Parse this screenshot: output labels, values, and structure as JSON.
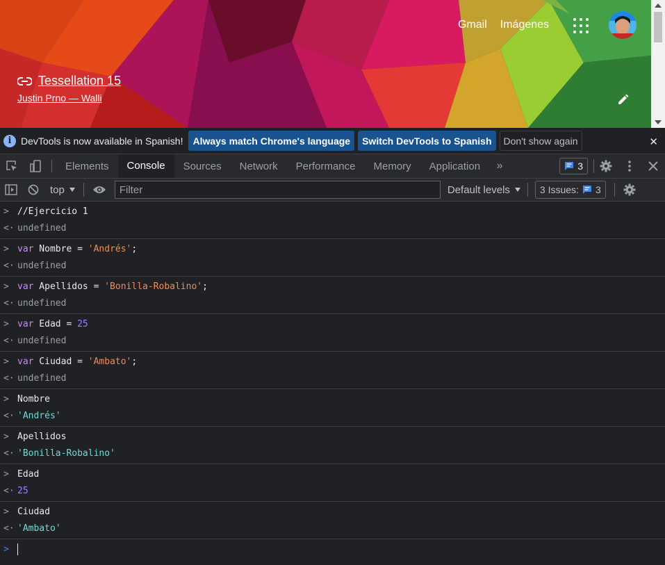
{
  "page": {
    "links": [
      "Gmail",
      "Imágenes"
    ],
    "credit_title": "Tessellation 15",
    "credit_author": "Justin Prno — Walli"
  },
  "infobar": {
    "message": "DevTools is now available in Spanish!",
    "btn_match": "Always match Chrome's language",
    "btn_switch": "Switch DevTools to Spanish",
    "btn_dismiss": "Don't show again",
    "close": "✕"
  },
  "tabs": [
    "Elements",
    "Console",
    "Sources",
    "Network",
    "Performance",
    "Memory",
    "Application"
  ],
  "active_tab": "Console",
  "tabbar": {
    "issue_count": "3"
  },
  "toolbar": {
    "context": "top",
    "filter_placeholder": "Filter",
    "levels": "Default levels",
    "issues_label": "3 Issues:",
    "issues_count": "3"
  },
  "console": {
    "entries": [
      {
        "input": [
          {
            "t": "//Ejercicio 1",
            "c": "plain"
          }
        ],
        "output": "undefined",
        "out_type": "undef"
      },
      {
        "input": [
          {
            "t": "var",
            "c": "kw"
          },
          {
            "t": " Nombre = ",
            "c": "plain"
          },
          {
            "t": "'Andrés'",
            "c": "str"
          },
          {
            "t": ";",
            "c": "plain"
          }
        ],
        "output": "undefined",
        "out_type": "undef"
      },
      {
        "input": [
          {
            "t": "var",
            "c": "kw"
          },
          {
            "t": " Apellidos = ",
            "c": "plain"
          },
          {
            "t": "'Bonilla-Robalino'",
            "c": "str"
          },
          {
            "t": ";",
            "c": "plain"
          }
        ],
        "output": "undefined",
        "out_type": "undef"
      },
      {
        "input": [
          {
            "t": "var",
            "c": "kw"
          },
          {
            "t": " Edad = ",
            "c": "plain"
          },
          {
            "t": "25",
            "c": "num"
          }
        ],
        "output": "undefined",
        "out_type": "undef"
      },
      {
        "input": [
          {
            "t": "var",
            "c": "kw"
          },
          {
            "t": " Ciudad = ",
            "c": "plain"
          },
          {
            "t": "'Ambato'",
            "c": "str"
          },
          {
            "t": ";",
            "c": "plain"
          }
        ],
        "output": "undefined",
        "out_type": "undef"
      },
      {
        "input": [
          {
            "t": "Nombre",
            "c": "plain"
          }
        ],
        "output": "'Andrés'",
        "out_type": "resstr"
      },
      {
        "input": [
          {
            "t": "Apellidos",
            "c": "plain"
          }
        ],
        "output": "'Bonilla-Robalino'",
        "out_type": "resstr"
      },
      {
        "input": [
          {
            "t": "Edad",
            "c": "plain"
          }
        ],
        "output": "25",
        "out_type": "resnum"
      },
      {
        "input": [
          {
            "t": "Ciudad",
            "c": "plain"
          }
        ],
        "output": "'Ambato'",
        "out_type": "resstr"
      }
    ]
  },
  "colors": {
    "devtools_bg": "#202124",
    "toolbar_bg": "#292a2d",
    "primary_button": "#1a5490",
    "keyword": "#c58af9",
    "string": "#f28b54",
    "result_string": "#6fdcd4",
    "number": "#9980ff",
    "accent": "#8ab4f8"
  },
  "icons": [
    "link-icon",
    "apps-grid-icon",
    "edit-pencil-icon",
    "info-icon",
    "inspect-element-icon",
    "device-toolbar-icon",
    "more-tabs-icon",
    "issues-message-icon",
    "settings-gear-icon",
    "kebab-menu-icon",
    "close-icon",
    "sidebar-toggle-icon",
    "clear-console-icon",
    "live-expression-eye-icon"
  ]
}
